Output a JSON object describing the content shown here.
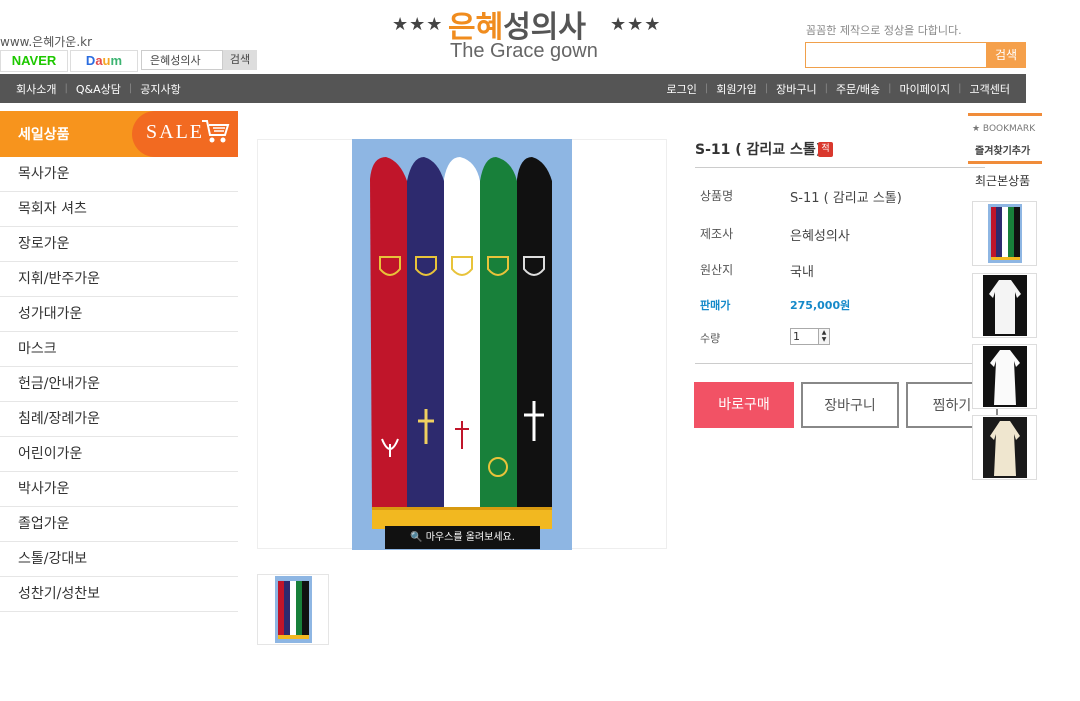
{
  "header": {
    "site_url": "www.은혜가운.kr",
    "naver_label": "NAVER",
    "daum_letters": [
      "D",
      "a",
      "u",
      "m"
    ],
    "top_search_value": "은혜성의사",
    "top_search_button": "검색",
    "logo_stars": "★★★",
    "logo_kr_part1": "은혜",
    "logo_kr_part2": "성의사",
    "logo_en": "The Grace gown",
    "tagline": "꼼꼼한 제작으로 정상을 다합니다.",
    "search_placeholder": "",
    "search_button": "검색",
    "brand_orange": "#f08c1e"
  },
  "nav": {
    "left": [
      "회사소개",
      "Q&A상담",
      "공지사항"
    ],
    "right": [
      "로그인",
      "회원가입",
      "장바구니",
      "주문/배송",
      "마이페이지",
      "고객센터"
    ]
  },
  "sidebar": {
    "sale_label": "세일상품",
    "sale_badge": "SALE",
    "categories": [
      "목사가운",
      "목회자 셔츠",
      "장로가운",
      "지휘/반주가운",
      "성가대가운",
      "마스크",
      "헌금/안내가운",
      "침례/장례가운",
      "어린이가운",
      "박사가운",
      "졸업가운",
      "스톨/강대보",
      "성찬기/성찬보"
    ]
  },
  "product": {
    "title": "S-11 ( 감리교 스톨)",
    "badge": "적",
    "zoom_hint": "마우스를 올려보세요.",
    "rows": [
      {
        "label": "상품명",
        "value": "S-11 ( 감리교 스톨)"
      },
      {
        "label": "제조사",
        "value": "은혜성의사"
      },
      {
        "label": "원산지",
        "value": "국내"
      }
    ],
    "price_label": "판매가",
    "price_value": "275,000원",
    "qty_label": "수량",
    "qty_value": "1",
    "buy_button": "바로구매",
    "cart_button": "장바구니",
    "wish_button": "찜하기"
  },
  "right_rail": {
    "bookmark_title": "★ BOOKMARK",
    "bookmark_sub": "즐겨찾기추가",
    "recent_title": "최근본상품"
  }
}
